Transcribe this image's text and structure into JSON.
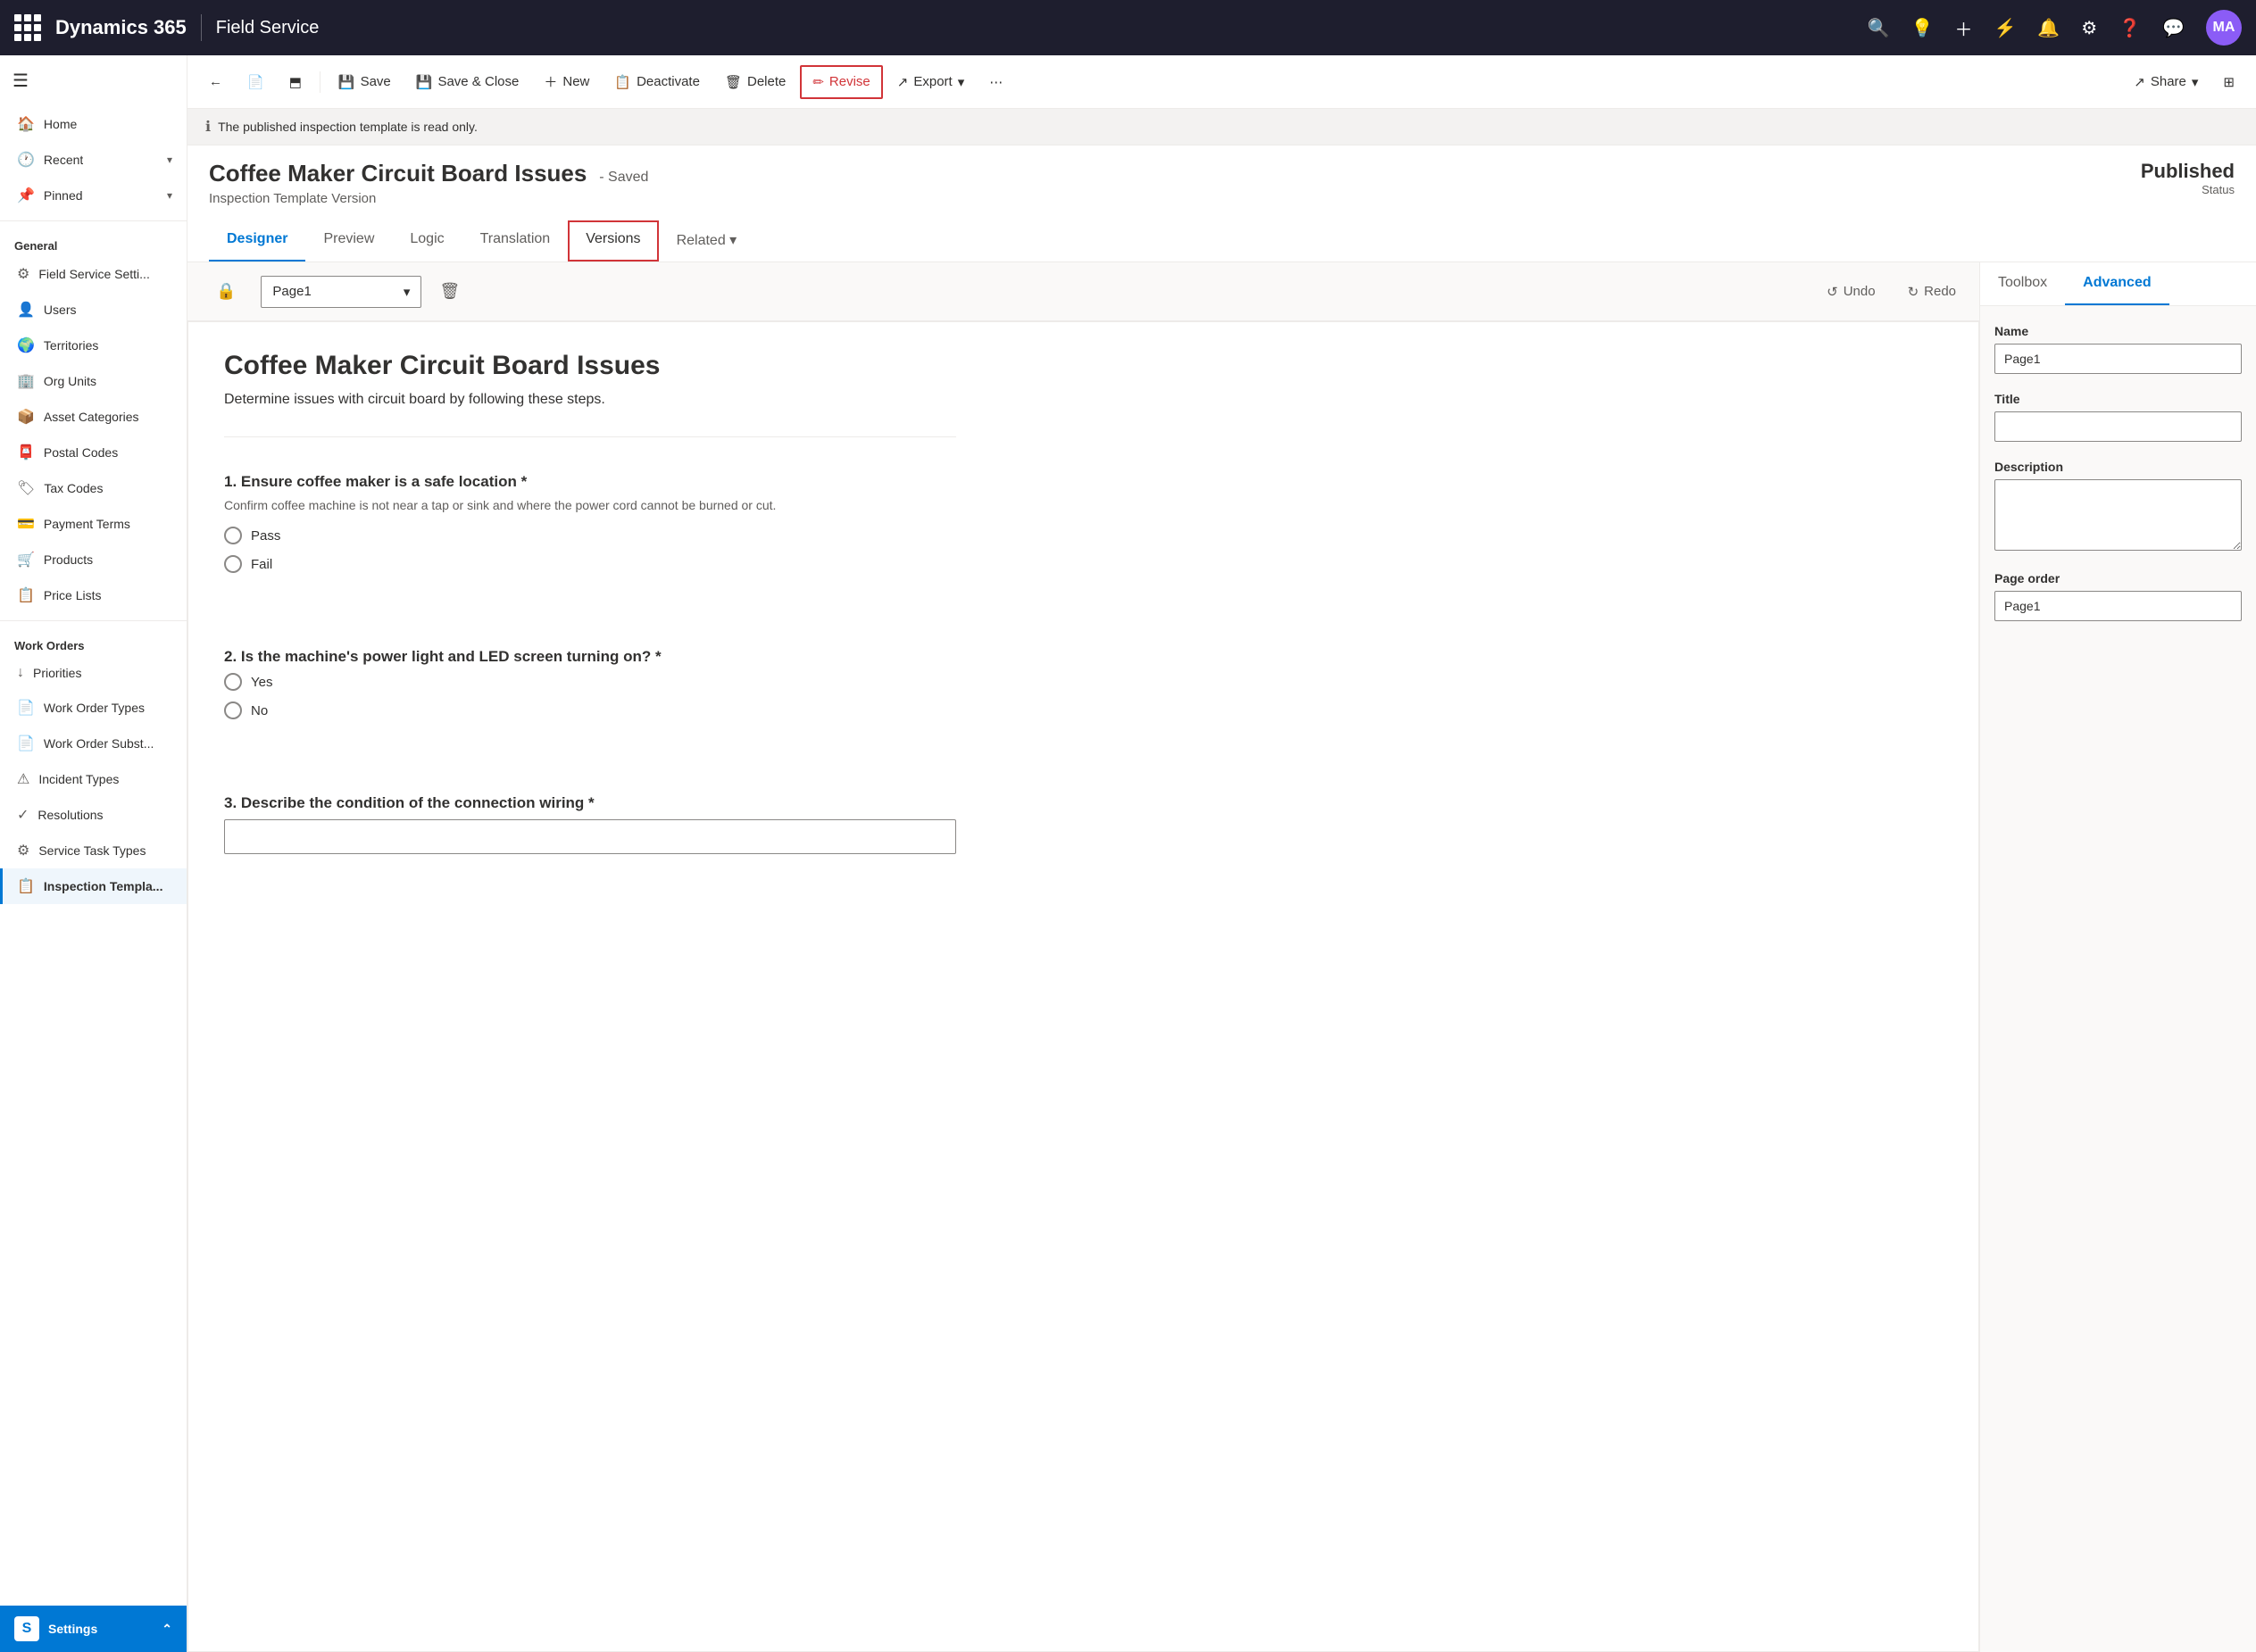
{
  "topNav": {
    "brand": "Dynamics 365",
    "product": "Field Service",
    "avatarInitials": "MA"
  },
  "commandBar": {
    "back": "←",
    "save": "Save",
    "saveClose": "Save & Close",
    "new": "New",
    "deactivate": "Deactivate",
    "delete": "Delete",
    "revise": "Revise",
    "export": "Export",
    "share": "Share"
  },
  "infoBar": {
    "message": "The published inspection template is read only."
  },
  "record": {
    "title": "Coffee Maker Circuit Board Issues",
    "savedStatus": "- Saved",
    "subtitle": "Inspection Template Version",
    "statusLabel": "Published",
    "statusSub": "Status"
  },
  "tabs": [
    {
      "label": "Designer",
      "active": true
    },
    {
      "label": "Preview"
    },
    {
      "label": "Logic"
    },
    {
      "label": "Translation"
    },
    {
      "label": "Versions",
      "outlined": true
    },
    {
      "label": "Related ▾"
    }
  ],
  "canvasToolbar": {
    "pageName": "Page1",
    "undoLabel": "Undo",
    "redoLabel": "Redo"
  },
  "canvas": {
    "title": "Coffee Maker Circuit Board Issues",
    "description": "Determine issues with circuit board by following these steps.",
    "questions": [
      {
        "id": "q1",
        "title": "1. Ensure coffee maker is a safe location *",
        "description": "Confirm coffee machine is not near a tap or sink and where the power cord cannot be burned or cut.",
        "type": "radio",
        "options": [
          "Pass",
          "Fail"
        ]
      },
      {
        "id": "q2",
        "title": "2. Is the machine's power light and LED screen turning on? *",
        "description": "",
        "type": "radio",
        "options": [
          "Yes",
          "No"
        ]
      },
      {
        "id": "q3",
        "title": "3. Describe the condition of the connection wiring *",
        "description": "",
        "type": "text",
        "options": []
      }
    ]
  },
  "rightPanel": {
    "tabs": [
      {
        "label": "Toolbox"
      },
      {
        "label": "Advanced",
        "active": true
      }
    ],
    "fields": {
      "nameLabel": "Name",
      "nameValue": "Page1",
      "titleLabel": "Title",
      "titleValue": "",
      "descriptionLabel": "Description",
      "descriptionValue": "",
      "pageOrderLabel": "Page order",
      "pageOrderValue": "Page1"
    }
  },
  "sidebar": {
    "sections": [
      {
        "label": "General",
        "items": [
          {
            "icon": "🏠",
            "label": "Home"
          },
          {
            "icon": "🕐",
            "label": "Recent",
            "chevron": true
          },
          {
            "icon": "📌",
            "label": "Pinned",
            "chevron": true
          }
        ]
      },
      {
        "label": "General",
        "items": [
          {
            "icon": "⚙",
            "label": "Field Service Setti..."
          },
          {
            "icon": "👤",
            "label": "Users"
          },
          {
            "icon": "🌍",
            "label": "Territories"
          },
          {
            "icon": "🏢",
            "label": "Org Units"
          },
          {
            "icon": "📦",
            "label": "Asset Categories"
          },
          {
            "icon": "📮",
            "label": "Postal Codes"
          },
          {
            "icon": "🏷",
            "label": "Tax Codes"
          },
          {
            "icon": "💳",
            "label": "Payment Terms"
          },
          {
            "icon": "🛒",
            "label": "Products"
          },
          {
            "icon": "📋",
            "label": "Price Lists"
          }
        ]
      },
      {
        "label": "Work Orders",
        "items": [
          {
            "icon": "↓",
            "label": "Priorities"
          },
          {
            "icon": "📄",
            "label": "Work Order Types"
          },
          {
            "icon": "📄",
            "label": "Work Order Subst..."
          },
          {
            "icon": "⚠",
            "label": "Incident Types"
          },
          {
            "icon": "✓",
            "label": "Resolutions"
          },
          {
            "icon": "⚙",
            "label": "Service Task Types"
          },
          {
            "icon": "📋",
            "label": "Inspection Templa...",
            "active": true
          }
        ]
      }
    ],
    "settings": {
      "icon": "S",
      "label": "Settings",
      "chevron": true
    }
  }
}
